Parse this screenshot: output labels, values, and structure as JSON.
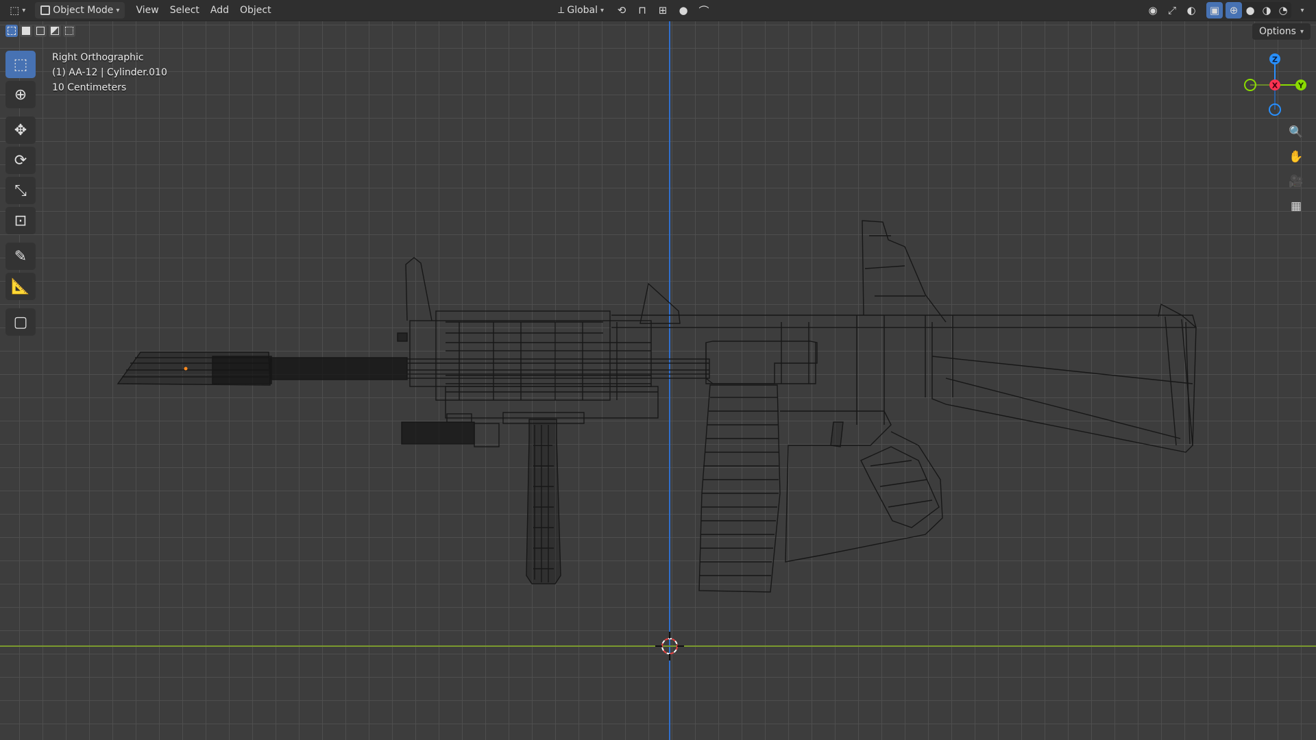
{
  "header": {
    "editor_type_icon": "view3d-icon",
    "mode_label": "Object Mode",
    "menus": [
      "View",
      "Select",
      "Add",
      "Object"
    ],
    "transform_orientation": "Global"
  },
  "options_label": "Options",
  "overlay": {
    "view_name": "Right Orthographic",
    "object_info": "(1) AA-12 | Cylinder.010",
    "grid_scale": "10 Centimeters"
  },
  "gizmo": {
    "z_label": "Z",
    "x_label": "X",
    "y_label": "Y",
    "colors": {
      "x": "#ff3352",
      "y": "#8bdc00",
      "z": "#2890ff"
    }
  },
  "toolbar": {
    "tools": [
      "select-box",
      "cursor",
      "move",
      "rotate",
      "scale",
      "transform",
      "annotate",
      "measure",
      "add-cube"
    ],
    "active_tool": "select-box"
  },
  "viewport": {
    "shading_active": "wireframe",
    "colors": {
      "grid": "#505050",
      "background": "#3d3d3d",
      "vertical_axis": "#2f6fce",
      "horizontal_axis": "#7a9a2e"
    }
  }
}
